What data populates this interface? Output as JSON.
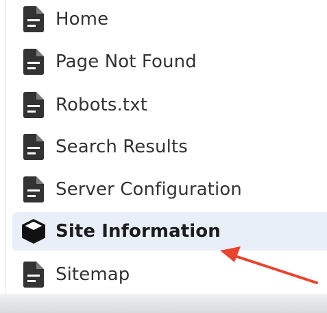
{
  "sidebar": {
    "items": [
      {
        "label": "Home",
        "icon": "document-icon",
        "active": false
      },
      {
        "label": "Page Not Found",
        "icon": "document-icon",
        "active": false
      },
      {
        "label": "Robots.txt",
        "icon": "document-icon",
        "active": false
      },
      {
        "label": "Search Results",
        "icon": "document-icon",
        "active": false
      },
      {
        "label": "Server Configuration",
        "icon": "document-icon",
        "active": false
      },
      {
        "label": "Site Information",
        "icon": "cube-icon",
        "active": true
      },
      {
        "label": "Sitemap",
        "icon": "document-icon",
        "active": false
      }
    ]
  },
  "colors": {
    "active_background": "#e8eff8",
    "icon": "#333333",
    "annotation_arrow": "#e8452f"
  }
}
